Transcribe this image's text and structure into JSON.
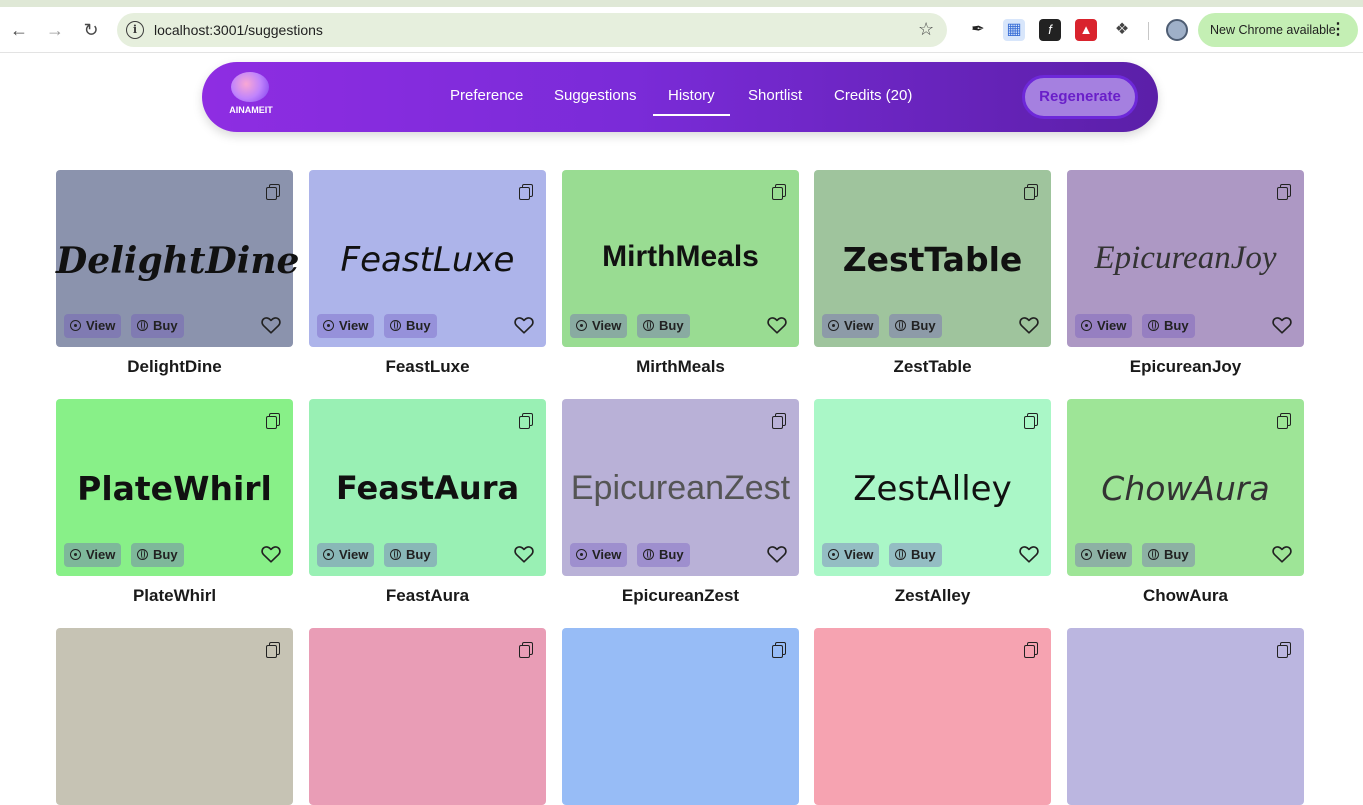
{
  "browser": {
    "url": "localhost:3001/suggestions",
    "update_label": "New Chrome available"
  },
  "app": {
    "logo_text": "AINAMEIT",
    "nav": [
      "Preference",
      "Suggestions",
      "History",
      "Shortlist",
      "Credits (20)"
    ],
    "active_nav": "History",
    "regenerate_label": "Regenerate"
  },
  "card_labels": {
    "view": "View",
    "buy": "Buy"
  },
  "cards": [
    {
      "name": "DelightDine",
      "color": "#8b93ad",
      "wordmark_style": "script-bold"
    },
    {
      "name": "FeastLuxe",
      "color": "#adb4ea",
      "wordmark_style": "italic-sans"
    },
    {
      "name": "MirthMeals",
      "color": "#99dc92",
      "wordmark_style": "bold-sans"
    },
    {
      "name": "ZestTable",
      "color": "#9fc49d",
      "wordmark_style": "heavy-sans"
    },
    {
      "name": "EpicureanJoy",
      "color": "#ad98c4",
      "wordmark_style": "italic-serif"
    },
    {
      "name": "PlateWhirl",
      "color": "#88f088",
      "wordmark_style": "heavy-sans"
    },
    {
      "name": "FeastAura",
      "color": "#99f0b4",
      "wordmark_style": "bold-rounded"
    },
    {
      "name": "EpicureanZest",
      "color": "#b9b1d7",
      "wordmark_style": "light-sans"
    },
    {
      "name": "ZestAlley",
      "color": "#aaf7c7",
      "wordmark_style": "regular-sans"
    },
    {
      "name": "ChowAura",
      "color": "#9ee597",
      "wordmark_style": "light-italic"
    },
    {
      "name": "",
      "color": "#c6c3b4",
      "wordmark_style": ""
    },
    {
      "name": "",
      "color": "#e99db6",
      "wordmark_style": ""
    },
    {
      "name": "",
      "color": "#97bcf6",
      "wordmark_style": ""
    },
    {
      "name": "",
      "color": "#f6a3b1",
      "wordmark_style": ""
    },
    {
      "name": "",
      "color": "#bbb6e0",
      "wordmark_style": ""
    }
  ]
}
